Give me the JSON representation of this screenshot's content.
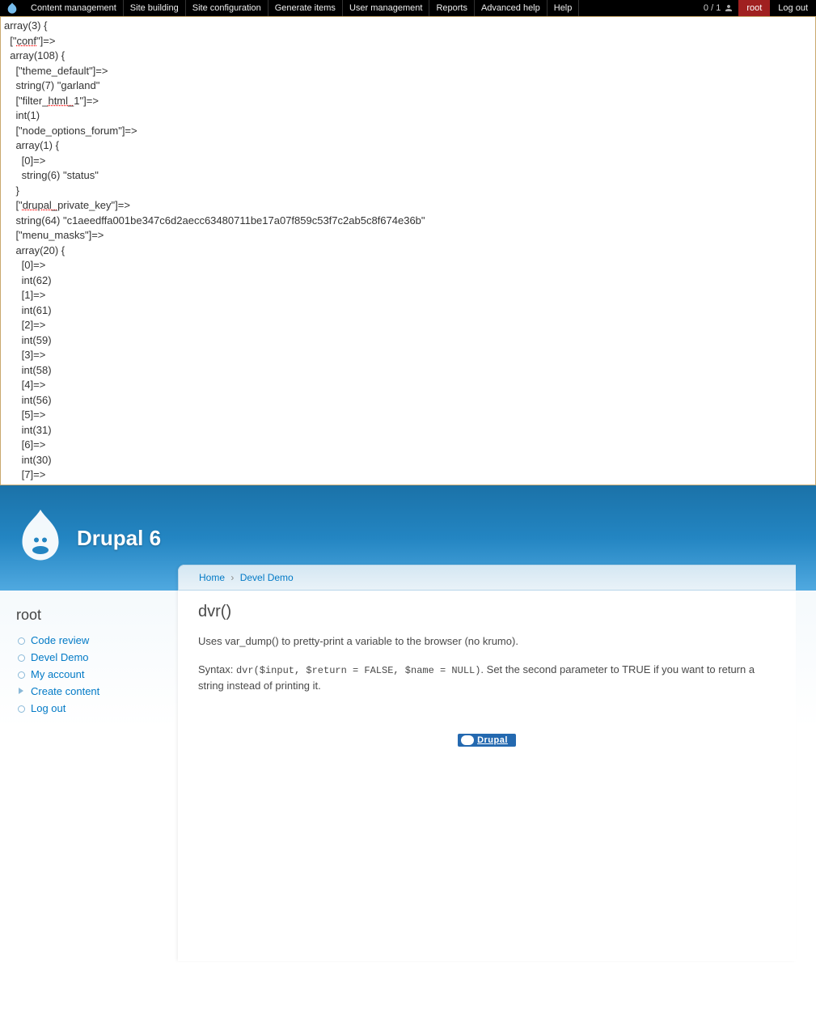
{
  "adminMenu": {
    "items": [
      "Content management",
      "Site building",
      "Site configuration",
      "Generate items",
      "User management",
      "Reports",
      "Advanced help",
      "Help"
    ],
    "usersCount": "0 / 1",
    "userBtn": "root",
    "logout": "Log out"
  },
  "develOutput": {
    "lines": [
      {
        "indent": 0,
        "text": "array(3) {"
      },
      {
        "indent": 1,
        "pre": "[\"",
        "u": "conf",
        "post": "\"]=>"
      },
      {
        "indent": 1,
        "text": "array(108) {"
      },
      {
        "indent": 2,
        "text": "[\"theme_default\"]=>"
      },
      {
        "indent": 2,
        "text": "string(7) \"garland\""
      },
      {
        "indent": 2,
        "pre": "[\"filter_",
        "u": "html_",
        "post": "1\"]=>"
      },
      {
        "indent": 2,
        "text": "int(1)"
      },
      {
        "indent": 2,
        "text": "[\"node_options_forum\"]=>"
      },
      {
        "indent": 2,
        "text": "array(1) {"
      },
      {
        "indent": 3,
        "text": "[0]=>"
      },
      {
        "indent": 3,
        "text": "string(6) \"status\""
      },
      {
        "indent": 2,
        "text": "}"
      },
      {
        "indent": 2,
        "pre": "[\"",
        "u": "drupal_",
        "post": "private_key\"]=>"
      },
      {
        "indent": 2,
        "text": "string(64) \"c1aeedffa001be347c6d2aecc63480711be17a07f859c53f7c2ab5c8f674e36b\""
      },
      {
        "indent": 2,
        "text": "[\"menu_masks\"]=>"
      },
      {
        "indent": 2,
        "text": "array(20) {"
      },
      {
        "indent": 3,
        "text": "[0]=>"
      },
      {
        "indent": 3,
        "text": "int(62)"
      },
      {
        "indent": 3,
        "text": "[1]=>"
      },
      {
        "indent": 3,
        "text": "int(61)"
      },
      {
        "indent": 3,
        "text": "[2]=>"
      },
      {
        "indent": 3,
        "text": "int(59)"
      },
      {
        "indent": 3,
        "text": "[3]=>"
      },
      {
        "indent": 3,
        "text": "int(58)"
      },
      {
        "indent": 3,
        "text": "[4]=>"
      },
      {
        "indent": 3,
        "text": "int(56)"
      },
      {
        "indent": 3,
        "text": "[5]=>"
      },
      {
        "indent": 3,
        "text": "int(31)"
      },
      {
        "indent": 3,
        "text": "[6]=>"
      },
      {
        "indent": 3,
        "text": "int(30)"
      },
      {
        "indent": 3,
        "text": "[7]=>"
      }
    ]
  },
  "header": {
    "siteName": "Drupal 6"
  },
  "sidebar": {
    "title": "root",
    "items": [
      {
        "label": "Code review",
        "arrow": false
      },
      {
        "label": "Devel Demo",
        "arrow": false
      },
      {
        "label": "My account",
        "arrow": false
      },
      {
        "label": "Create content",
        "arrow": true
      },
      {
        "label": "Log out",
        "arrow": false
      }
    ]
  },
  "breadcrumb": {
    "home": "Home",
    "sep": "›",
    "current": "Devel Demo"
  },
  "content": {
    "title": "dvr()",
    "p1": "Uses var_dump() to pretty-print a variable to the browser (no krumo).",
    "p2_pre": "Syntax: ",
    "p2_code": "dvr($input, $return = FALSE, $name = NULL)",
    "p2_post": ". Set the second parameter to TRUE if you want to return a string instead of printing it."
  },
  "footer": {
    "badge": "Drupal"
  }
}
